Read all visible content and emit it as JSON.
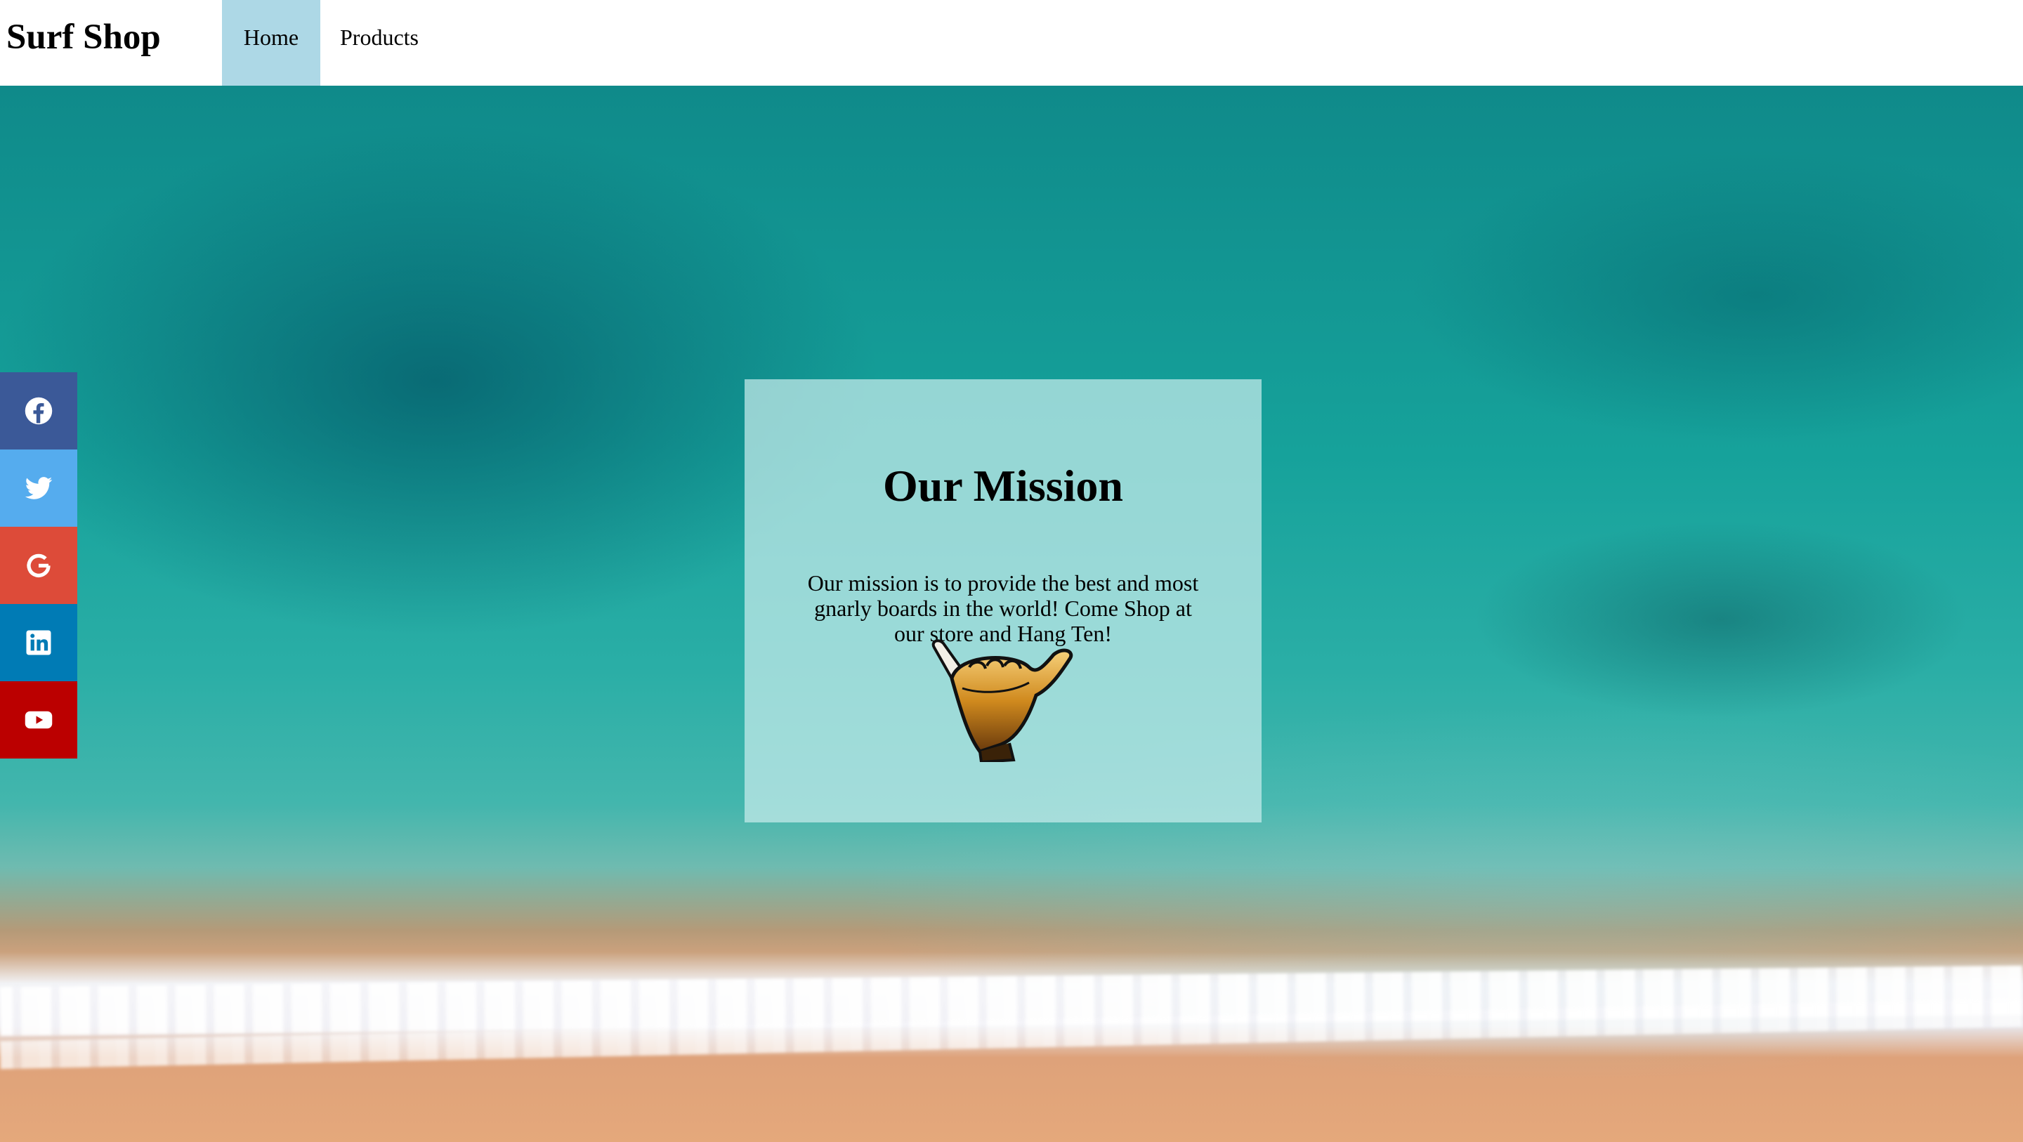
{
  "header": {
    "brand": "Surf Shop",
    "nav": [
      {
        "label": "Home",
        "active": true
      },
      {
        "label": "Products",
        "active": false
      }
    ]
  },
  "social": [
    {
      "icon": "facebook-icon",
      "color": "#3b5998"
    },
    {
      "icon": "twitter-icon",
      "color": "#55acee"
    },
    {
      "icon": "google-icon",
      "color": "#dd4b39"
    },
    {
      "icon": "linkedin-icon",
      "color": "#007bb5"
    },
    {
      "icon": "youtube-icon",
      "color": "#bb0000"
    }
  ],
  "mission": {
    "title": "Our Mission",
    "text": "Our mission is to provide the best and most gnarly boards in the world! Come Shop at our store and Hang Ten!",
    "icon": "shaka-hand-icon"
  },
  "colors": {
    "nav_active_bg": "#add8e6",
    "card_bg": "#c8ebeb"
  }
}
